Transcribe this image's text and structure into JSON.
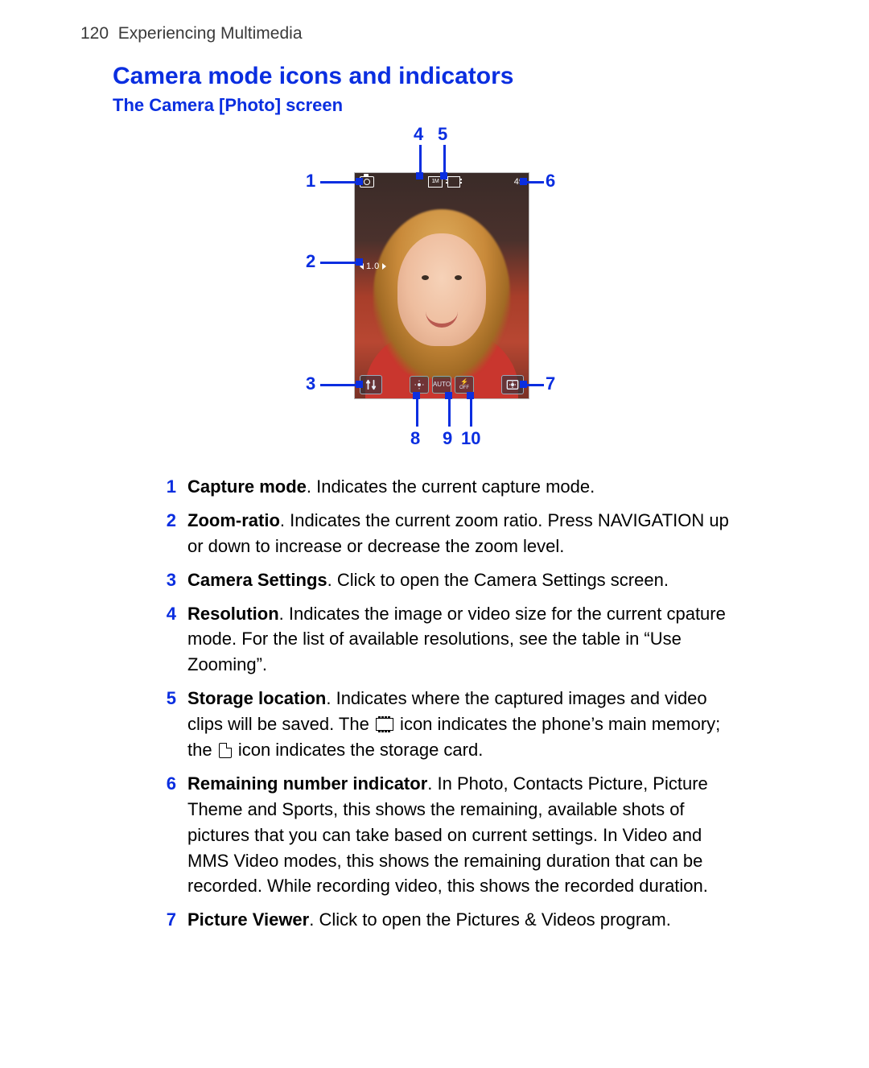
{
  "header": {
    "page_no": "120",
    "chapter": "Experiencing Multimedia"
  },
  "h1": "Camera mode icons and indicators",
  "h2": "The Camera [Photo] screen",
  "screen": {
    "resolution_badge": "1M",
    "remaining": "49",
    "zoom": "1.0",
    "mini_wb": "AUTO",
    "mini_flash": "OFF"
  },
  "call": {
    "c1": "1",
    "c2": "2",
    "c3": "3",
    "c4": "4",
    "c5": "5",
    "c6": "6",
    "c7": "7",
    "c8": "8",
    "c9": "9",
    "c10": "10"
  },
  "items": [
    {
      "n": "1",
      "title": "Capture mode",
      "text_a": ". Indicates the current capture mode."
    },
    {
      "n": "2",
      "title": "Zoom-ratio",
      "text_a": ". Indicates the current zoom ratio. Press NAVIGATION up or down to increase or decrease the zoom level."
    },
    {
      "n": "3",
      "title": "Camera Settings",
      "text_a": ". Click to open the Camera Settings screen."
    },
    {
      "n": "4",
      "title": "Resolution",
      "text_a": ". Indicates the image or video size for the current cpature mode. For the list of available resolutions, see the table in “Use Zooming”."
    },
    {
      "n": "5",
      "title": "Storage location",
      "text_a": ". Indicates where the captured images and video clips will be saved. The ",
      "text_b": " icon indicates the phone’s main memory; the ",
      "text_c": " icon indicates the storage card."
    },
    {
      "n": "6",
      "title": "Remaining number indicator",
      "text_a": ". In Photo, Contacts Picture, Picture Theme and Sports, this shows the remaining, available shots of pictures that you can take based on current settings. In Video and MMS Video modes, this shows the remaining duration that can be recorded. While recording video, this shows the recorded duration."
    },
    {
      "n": "7",
      "title": "Picture Viewer",
      "text_a": ". Click to open the Pictures & Videos program."
    }
  ]
}
